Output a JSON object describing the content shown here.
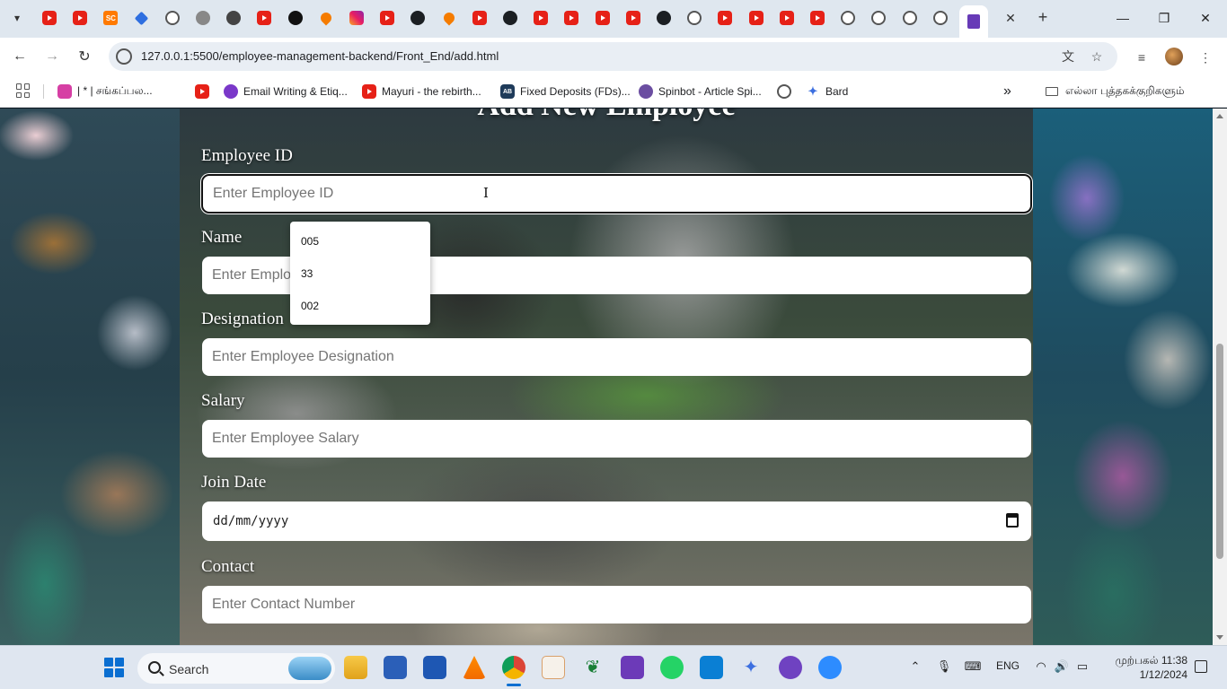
{
  "browser": {
    "tabs": [
      {
        "icon": "youtube-icon"
      },
      {
        "icon": "youtube-icon"
      },
      {
        "icon": "sc-icon",
        "text": "SC"
      },
      {
        "icon": "diamond-icon"
      },
      {
        "icon": "globe-icon"
      },
      {
        "icon": "arrow-icon"
      },
      {
        "icon": "camera-icon"
      },
      {
        "icon": "youtube-icon"
      },
      {
        "icon": "dark-circle-icon"
      },
      {
        "icon": "drop-icon"
      },
      {
        "icon": "instagram-icon"
      },
      {
        "icon": "youtube-icon"
      },
      {
        "icon": "github-icon"
      },
      {
        "icon": "drop-icon"
      },
      {
        "icon": "youtube-icon"
      },
      {
        "icon": "github-icon"
      },
      {
        "icon": "youtube-icon"
      },
      {
        "icon": "youtube-icon"
      },
      {
        "icon": "youtube-icon"
      },
      {
        "icon": "youtube-icon"
      },
      {
        "icon": "github-icon"
      },
      {
        "icon": "globe-icon"
      },
      {
        "icon": "youtube-icon"
      },
      {
        "icon": "youtube-icon"
      },
      {
        "icon": "youtube-icon"
      },
      {
        "icon": "youtube-icon"
      },
      {
        "icon": "globe-icon"
      },
      {
        "icon": "globe-icon"
      },
      {
        "icon": "globe-icon"
      },
      {
        "icon": "globe-icon"
      },
      {
        "icon": "form-icon",
        "active": true
      }
    ],
    "url": "127.0.0.1:5500/employee-management-backend/Front_End/add.html",
    "bookmarks": [
      {
        "label": "| * | சங்கப்பல...",
        "icon": "pink-icon"
      },
      {
        "label": "",
        "icon": "youtube-icon"
      },
      {
        "label": "Email Writing & Etiq...",
        "icon": "purple-circle-icon"
      },
      {
        "label": "Mayuri - the rebirth...",
        "icon": "youtube-icon"
      },
      {
        "label": "Fixed Deposits (FDs)...",
        "icon": "ab-icon"
      },
      {
        "label": "Spinbot - Article Spi...",
        "icon": "spinbot-icon"
      },
      {
        "label": "",
        "icon": "globe-icon"
      },
      {
        "label": "Bard",
        "icon": "bard-icon"
      }
    ],
    "all_bookmarks_label": "எல்லா புத்தகக்குறிகளும்",
    "overflow_glyph": "»"
  },
  "form": {
    "title": "Add New Employee",
    "fields": {
      "employee_id": {
        "label": "Employee ID",
        "placeholder": "Enter Employee ID",
        "value": ""
      },
      "name": {
        "label": "Name",
        "placeholder": "Enter Employee Name",
        "value": ""
      },
      "designation": {
        "label": "Designation",
        "placeholder": "Enter Employee Designation",
        "value": ""
      },
      "salary": {
        "label": "Salary",
        "placeholder": "Enter Employee Salary",
        "value": ""
      },
      "join_date": {
        "label": "Join Date",
        "placeholder": "dd/mm/yyyy",
        "value": ""
      },
      "contact": {
        "label": "Contact",
        "placeholder": "Enter Contact Number",
        "value": ""
      }
    },
    "autocomplete": [
      "005",
      "33",
      "002"
    ]
  },
  "taskbar": {
    "search_label": "Search",
    "language": "ENG",
    "time": "முற்பகல் 11:38",
    "date": "1/12/2024"
  }
}
